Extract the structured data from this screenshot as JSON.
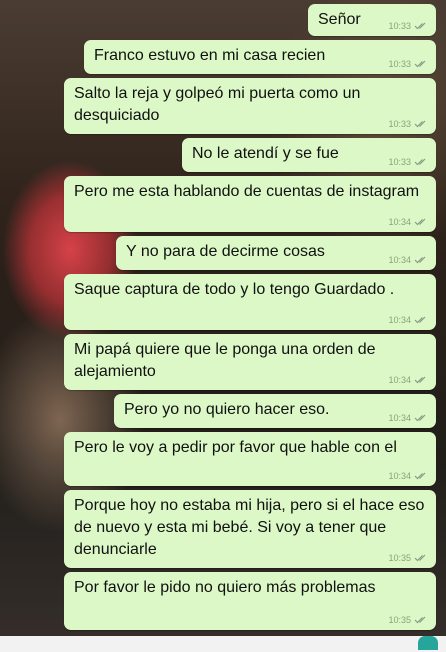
{
  "messages": [
    {
      "text": "Señor",
      "time": "10:33"
    },
    {
      "text": "Franco estuvo en mi casa recien",
      "time": "10:33"
    },
    {
      "text": "Salto la reja y golpeó mi puerta como un desquiciado",
      "time": "10:33"
    },
    {
      "text": "No le atendí y se fue",
      "time": "10:33"
    },
    {
      "text": "Pero me esta hablando de cuentas de instagram",
      "time": "10:34"
    },
    {
      "text": "Y no para de decirme cosas",
      "time": "10:34"
    },
    {
      "text": "Saque captura de todo y lo tengo Guardado .",
      "time": "10:34"
    },
    {
      "text": "Mi papá quiere que le ponga una orden de alejamiento",
      "time": "10:34"
    },
    {
      "text": "Pero yo no quiero hacer eso.",
      "time": "10:34"
    },
    {
      "text": "Pero le voy a pedir por favor que hable con el",
      "time": "10:34"
    },
    {
      "text": "Porque hoy no estaba mi hija, pero si el hace eso de nuevo y esta mi bebé.  Si voy a tener que denunciarle",
      "time": "10:35"
    },
    {
      "text": "Por favor le pido no quiero más problemas",
      "time": "10:35"
    }
  ],
  "colors": {
    "outgoing_bubble": "#dcf8c6",
    "ticks": "#8a9a86"
  },
  "icons": {
    "ticks": "double-check-icon"
  }
}
